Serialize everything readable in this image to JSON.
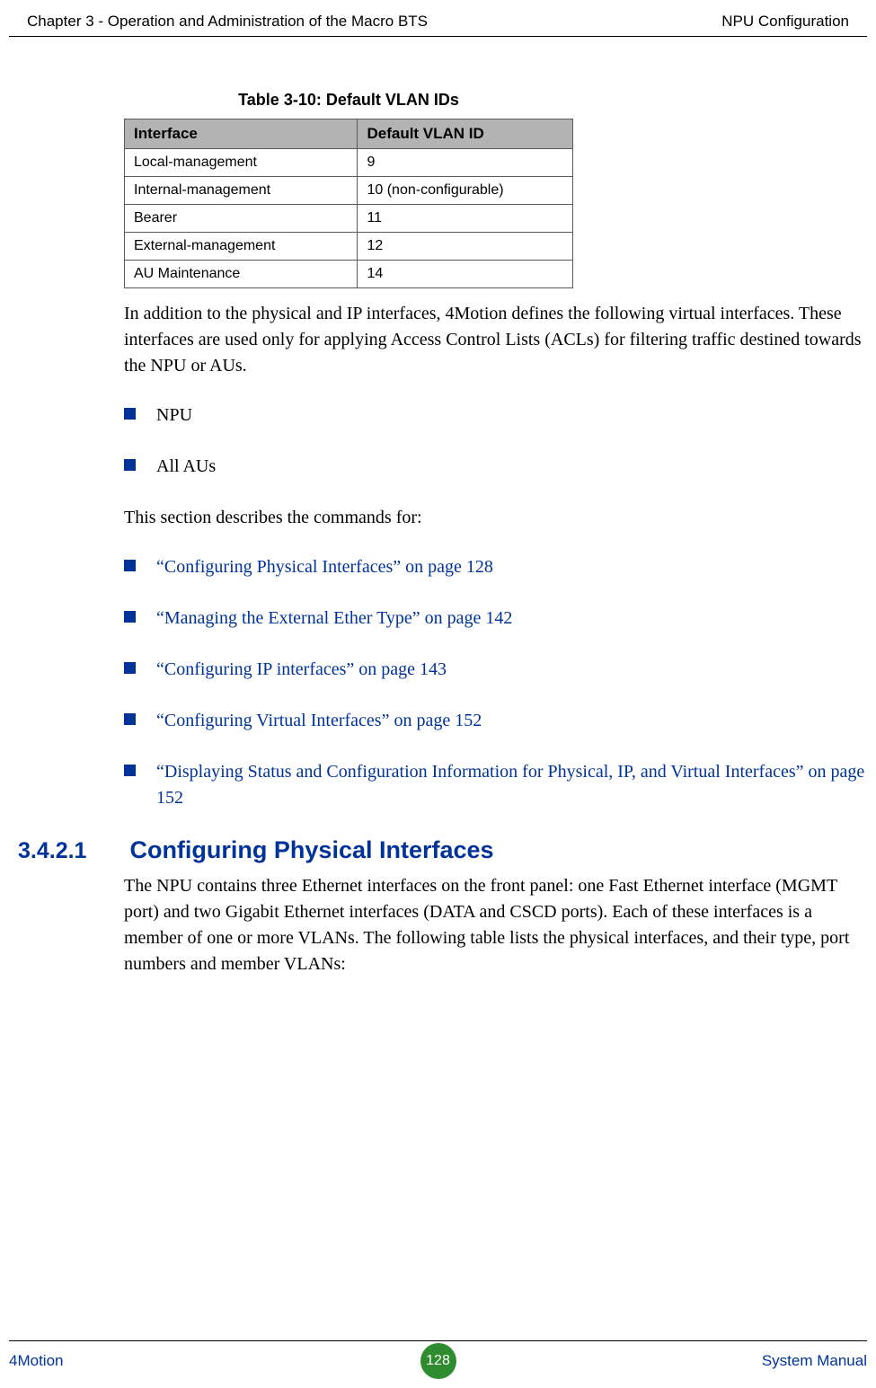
{
  "header": {
    "left": "Chapter 3 - Operation and Administration of the Macro BTS",
    "right": "NPU Configuration"
  },
  "table": {
    "caption": "Table 3-10: Default VLAN IDs",
    "col1": "Interface",
    "col2": "Default VLAN ID",
    "rows": [
      {
        "iface": "Local-management",
        "vid": "9"
      },
      {
        "iface": "Internal-management",
        "vid": "10 (non-configurable)"
      },
      {
        "iface": "Bearer",
        "vid": "11"
      },
      {
        "iface": "External-management",
        "vid": "12"
      },
      {
        "iface": "AU Maintenance",
        "vid": "14"
      }
    ]
  },
  "para1": "In addition to the physical and IP interfaces, 4Motion defines the following virtual interfaces. These interfaces are used only for applying Access Control Lists (ACLs) for filtering traffic destined towards the NPU or AUs.",
  "list1": {
    "i0": "NPU",
    "i1": "All AUs"
  },
  "para2": "This section describes the commands for:",
  "list2": {
    "i0": "“Configuring Physical Interfaces” on page 128",
    "i1": "“Managing the External Ether Type” on page 142",
    "i2": "“Configuring IP interfaces” on page 143",
    "i3": "“Configuring Virtual Interfaces” on page 152",
    "i4": "“Displaying Status and Configuration Information for Physical, IP, and Virtual Interfaces” on page 152"
  },
  "section": {
    "num": "3.4.2.1",
    "title": "Configuring Physical Interfaces",
    "body": "The NPU contains three Ethernet interfaces on the front panel: one Fast Ethernet interface (MGMT port) and two Gigabit Ethernet interfaces (DATA and CSCD ports). Each of these interfaces is a member of one or more VLANs. The following table lists the physical interfaces, and their type, port numbers and member VLANs:"
  },
  "footer": {
    "left": "4Motion",
    "page": "128",
    "right": "System Manual"
  }
}
